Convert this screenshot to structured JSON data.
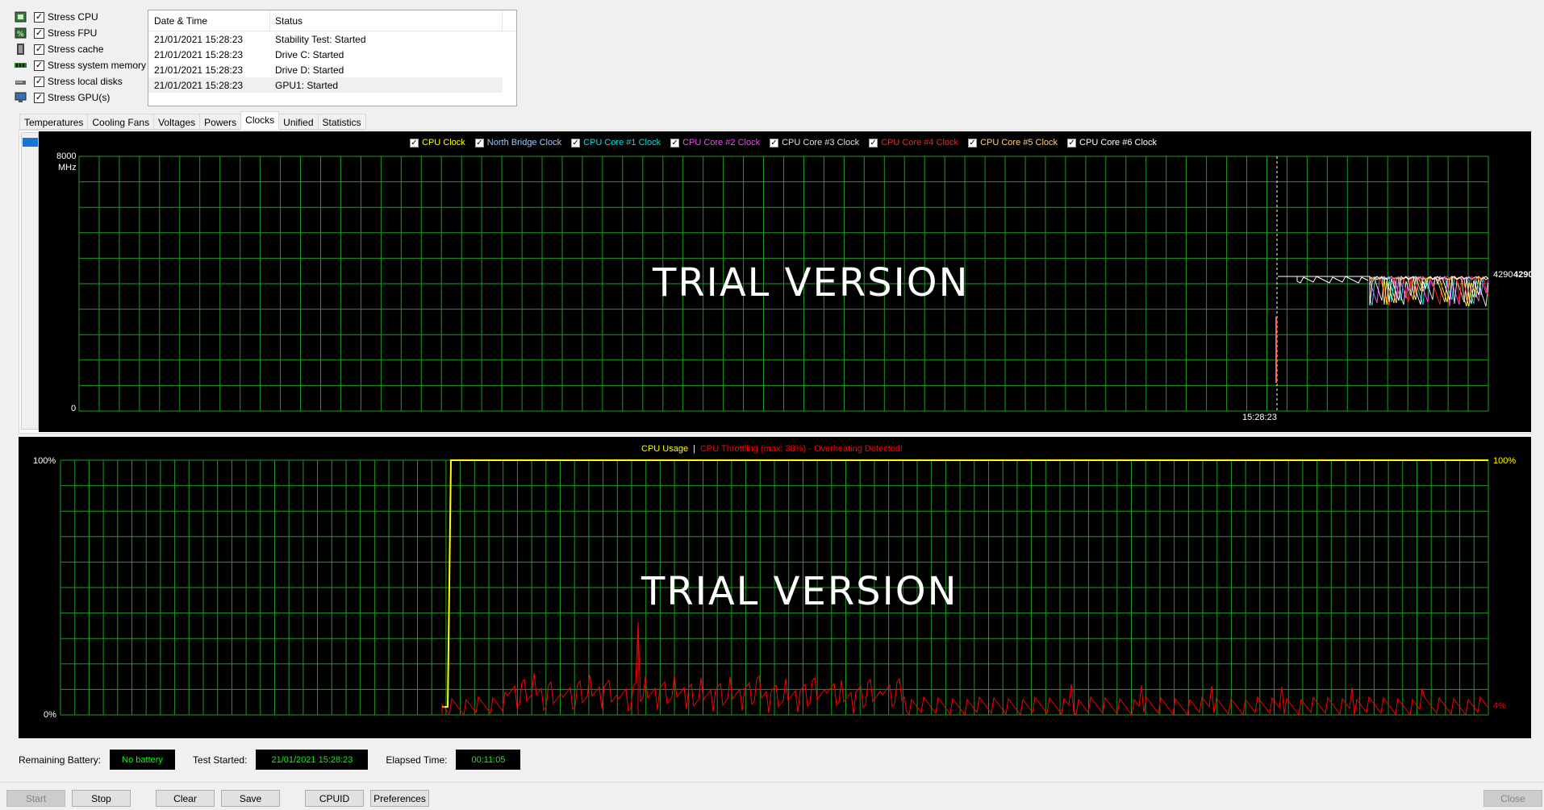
{
  "stress_options": [
    {
      "label": "Stress CPU",
      "checked": true,
      "icon": "cpu-icon"
    },
    {
      "label": "Stress FPU",
      "checked": true,
      "icon": "fpu-icon"
    },
    {
      "label": "Stress cache",
      "checked": true,
      "icon": "cache-icon"
    },
    {
      "label": "Stress system memory",
      "checked": true,
      "icon": "memory-icon"
    },
    {
      "label": "Stress local disks",
      "checked": true,
      "icon": "disk-icon"
    },
    {
      "label": "Stress GPU(s)",
      "checked": true,
      "icon": "gpu-icon"
    }
  ],
  "log": {
    "headers": {
      "date": "Date & Time",
      "status": "Status"
    },
    "rows": [
      {
        "date": "21/01/2021 15:28:23",
        "status": "Stability Test: Started"
      },
      {
        "date": "21/01/2021 15:28:23",
        "status": "Drive C: Started"
      },
      {
        "date": "21/01/2021 15:28:23",
        "status": "Drive D: Started"
      },
      {
        "date": "21/01/2021 15:28:23",
        "status": "GPU1: Started"
      }
    ]
  },
  "tabs": [
    "Temperatures",
    "Cooling Fans",
    "Voltages",
    "Powers",
    "Clocks",
    "Unified",
    "Statistics"
  ],
  "active_tab": "Clocks",
  "clock_graph": {
    "legend": [
      {
        "label": "CPU Clock",
        "color": "#ffff00"
      },
      {
        "label": "North Bridge Clock",
        "color": "#a0c8ff"
      },
      {
        "label": "CPU Core #1 Clock",
        "color": "#00e0e0"
      },
      {
        "label": "CPU Core #2 Clock",
        "color": "#ff40ff"
      },
      {
        "label": "CPU Core #3 Clock",
        "color": "#e0e0e0"
      },
      {
        "label": "CPU Core #4 Clock",
        "color": "#ff2020"
      },
      {
        "label": "CPU Core #5 Clock",
        "color": "#ffd080"
      },
      {
        "label": "CPU Core #6 Clock",
        "color": "#ffffff"
      }
    ],
    "y_max": "8000",
    "y_unit": "MHz",
    "y_min": "0",
    "time_label": "15:28:23",
    "value_label_1": "4290",
    "value_label_2": "4290",
    "watermark": "TRIAL VERSION"
  },
  "usage_graph": {
    "title_usage": "CPU Usage",
    "separator": "|",
    "title_throttle": "CPU Throttling (max: 38%) - Overheating Detected!",
    "y_max": "100%",
    "y_min": "0%",
    "right_usage": "100%",
    "right_throttle": "4%",
    "watermark": "TRIAL VERSION",
    "usage_color": "#ffff00",
    "throttle_color": "#ff0000"
  },
  "status": {
    "battery_label": "Remaining Battery:",
    "battery_value": "No battery",
    "started_label": "Test Started:",
    "started_value": "21/01/2021 15:28:23",
    "elapsed_label": "Elapsed Time:",
    "elapsed_value": "00:11:05"
  },
  "buttons": {
    "start": "Start",
    "stop": "Stop",
    "clear": "Clear",
    "save": "Save",
    "cpuid": "CPUID",
    "preferences": "Preferences",
    "close": "Close"
  }
}
